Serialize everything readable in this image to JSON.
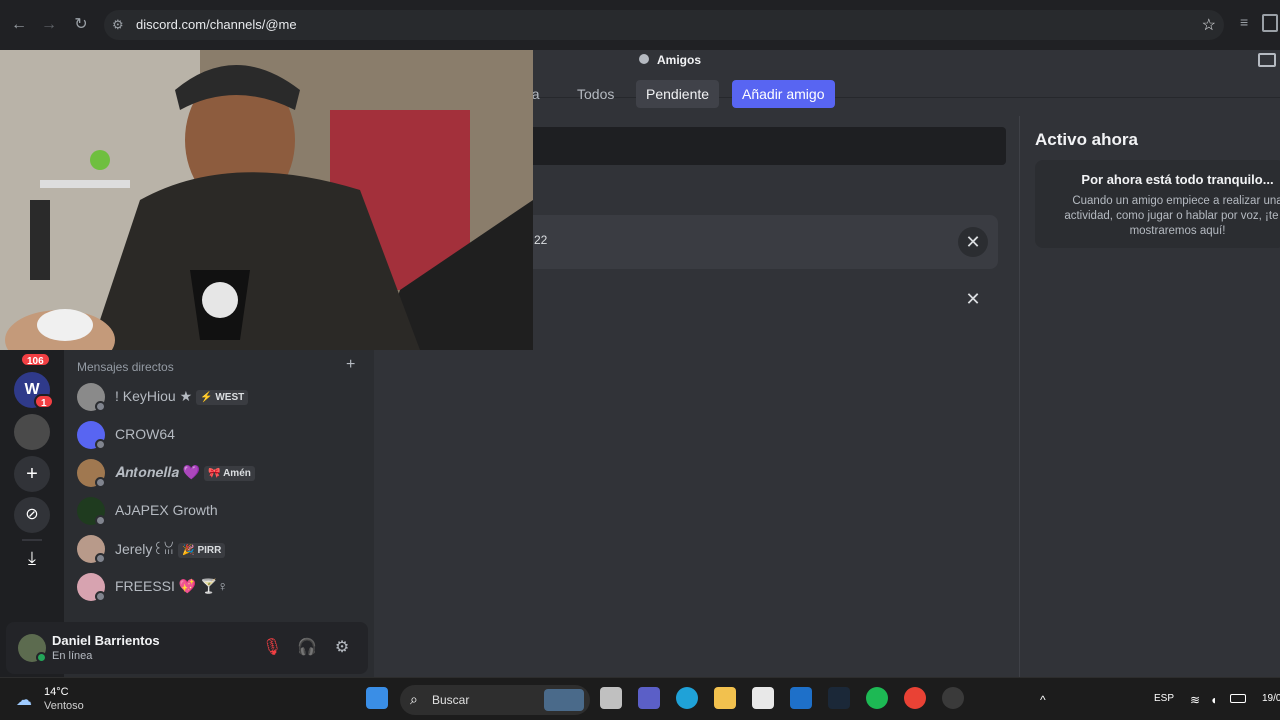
{
  "browser": {
    "url": "discord.com/channels/@me"
  },
  "header": {
    "title": "Amigos"
  },
  "tabs": [
    {
      "label": "ea"
    },
    {
      "label": "Todos"
    },
    {
      "label": "Pendiente"
    },
    {
      "label": "Añadir amigo"
    }
  ],
  "pending": {
    "row1_text": "22"
  },
  "active_now": {
    "title": "Activo ahora",
    "empty_heading": "Por ahora está todo tranquilo...",
    "empty_body": "Cuando un amigo empiece a realizar una actividad, como jugar o hablar por voz, ¡te lo mostraremos aquí!"
  },
  "servers": {
    "badge_top": "106",
    "badge_server1": "1"
  },
  "dms": {
    "header": "Mensajes directos",
    "items": [
      {
        "name": "! KeyHiou ★",
        "tag": "⚡ WEST"
      },
      {
        "name": "CROW64",
        "tag": ""
      },
      {
        "name": "𝑨𝒏𝒕𝒐𝒏𝒆𝒍𝒍𝒂 💜",
        "tag": "🎀 Amén"
      },
      {
        "name": "AJAPEX Growth",
        "tag": ""
      },
      {
        "name": "Jerely꒰ꈍ",
        "tag": "🎉 PIRR"
      },
      {
        "name": "FREESSI 💖 🍸♀",
        "tag": ""
      }
    ]
  },
  "user": {
    "name": "Daniel Barrientos",
    "status": "En línea"
  },
  "taskbar": {
    "temp": "14°C",
    "weather": "Ventoso",
    "search": "Buscar",
    "lang": "ESP",
    "date": "19/0"
  },
  "colors": {
    "blurple": "#5865f2",
    "online": "#23a559",
    "badge_red": "#f23f43"
  }
}
